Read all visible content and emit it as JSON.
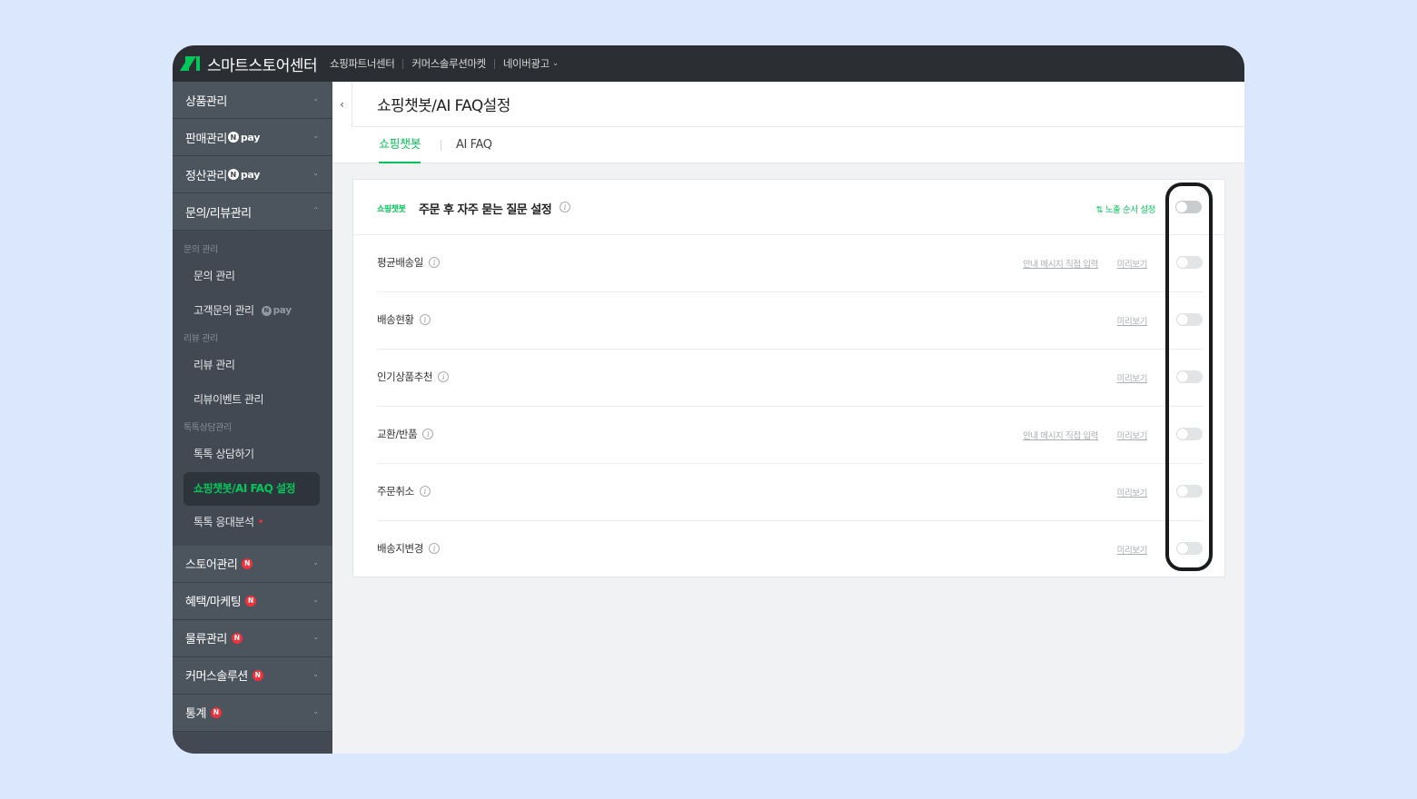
{
  "topbar": {
    "brand": "스마트스토어센터",
    "links": [
      "쇼핑파트너센터",
      "커머스솔루션마켓",
      "네이버광고"
    ]
  },
  "sidebar": {
    "main_items": [
      {
        "label": "상품관리"
      },
      {
        "label": "판매관리"
      },
      {
        "label": "정산관리"
      },
      {
        "label": "문의/리뷰관리"
      }
    ],
    "pay_text": "pay",
    "groups": {
      "inquiry": "문의 관리",
      "review": "리뷰 관리",
      "talk": "톡톡상담관리"
    },
    "sub_items": {
      "inquiry_manage": "문의 관리",
      "customer_inquiry": "고객문의 관리",
      "review_manage": "리뷰 관리",
      "review_event": "리뷰이벤트 관리",
      "talk_consult": "톡톡 상담하기",
      "chatbot_faq": "쇼핑챗봇/AI FAQ 설정",
      "talk_analysis": "톡톡 응대분석"
    },
    "bottom_items": [
      {
        "label": "스토어관리"
      },
      {
        "label": "혜택/마케팅"
      },
      {
        "label": "물류관리"
      },
      {
        "label": "커머스솔루션"
      },
      {
        "label": "통계"
      }
    ],
    "new_badge": "N"
  },
  "page": {
    "title": "쇼핑챗봇/AI FAQ설정",
    "tabs": [
      "쇼핑챗봇",
      "AI FAQ"
    ]
  },
  "card": {
    "badge": "쇼핑챗봇",
    "title": "주문 후 자주 묻는 질문 설정",
    "order_link": "노출 순서 설정",
    "preview_label": "미리보기",
    "message_label": "안내 메시지 직접 입력",
    "rows": [
      {
        "label": "평균배송일",
        "has_message": true,
        "enabled": false
      },
      {
        "label": "배송현황",
        "has_message": false,
        "enabled": false
      },
      {
        "label": "인기상품추천",
        "has_message": false,
        "enabled": false
      },
      {
        "label": "교환/반품",
        "has_message": true,
        "enabled": false
      },
      {
        "label": "주문취소",
        "has_message": false,
        "enabled": false
      },
      {
        "label": "배송지변경",
        "has_message": false,
        "enabled": false
      }
    ],
    "master_enabled": false
  },
  "colors": {
    "accent": "#03c75a",
    "topbar": "#2b2f33",
    "sidebar": "#424953",
    "badge_red": "#f0323c"
  }
}
